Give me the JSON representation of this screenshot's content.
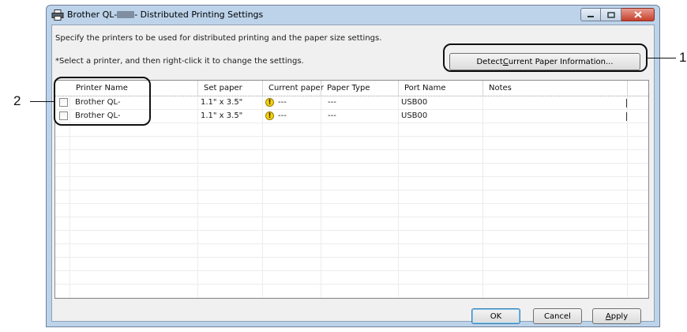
{
  "window": {
    "title_prefix": "Brother QL-",
    "title_suffix": "- Distributed Printing Settings"
  },
  "instructions": {
    "line1": "Specify the printers to be used for distributed printing and the paper size settings.",
    "line2": "*Select a printer, and then right-click it to change the settings."
  },
  "detect_button": {
    "before": "Detect ",
    "mnemonic": "C",
    "after": "urrent Paper Information..."
  },
  "table": {
    "columns": [
      "Printer Name",
      "Set paper",
      "Current paper",
      "Paper Type",
      "Port Name",
      "Notes"
    ],
    "rows": [
      {
        "printer_name": "Brother QL-",
        "set_paper": "1.1\" x 3.5\"",
        "current_paper": "---",
        "paper_type": "---",
        "port_name": "USB00",
        "checked": false
      },
      {
        "printer_name": "Brother QL-",
        "set_paper": "1.1\" x 3.5\"",
        "current_paper": "---",
        "paper_type": "---",
        "port_name": "USB00",
        "checked": false
      }
    ]
  },
  "buttons": {
    "ok": "OK",
    "cancel": "Cancel",
    "apply_mnemonic": "A",
    "apply_rest": "pply"
  },
  "callouts": {
    "one": "1",
    "two": "2"
  },
  "colors": {
    "warning": "#f4d20c",
    "close_button": "#c7402d",
    "frame": "#bcd3ea"
  }
}
